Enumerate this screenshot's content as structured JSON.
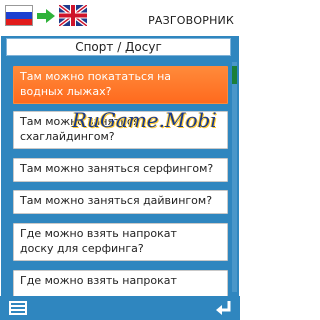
{
  "header": {
    "title": "РАЗГОВОРНИК",
    "from_flag": "russia-flag-icon",
    "to_flag": "uk-flag-icon",
    "arrow": "arrow-right-icon"
  },
  "category": {
    "label": "Спорт / Досуг"
  },
  "phrases": [
    {
      "text": "Там можно покататься на\nводных лыжах?",
      "selected": true
    },
    {
      "text": "Там можно заняться\nсхаглайдингом?",
      "selected": false
    },
    {
      "text": "Там можно заняться серфингом?",
      "selected": false
    },
    {
      "text": "Там можно заняться дайвингом?",
      "selected": false
    },
    {
      "text": "Где можно взять напрокат\nдоску для серфинга?",
      "selected": false
    },
    {
      "text": "Где можно взять напрокат",
      "selected": false
    }
  ],
  "watermark": {
    "text": "RuGame.Mobi"
  },
  "bottom": {
    "menu_icon": "menu-list-icon",
    "back_icon": "back-arrow-icon"
  },
  "colors": {
    "accent": "#2f86bf",
    "selected": "#ff6a1e",
    "scroll_thumb": "#1b7f3a"
  }
}
